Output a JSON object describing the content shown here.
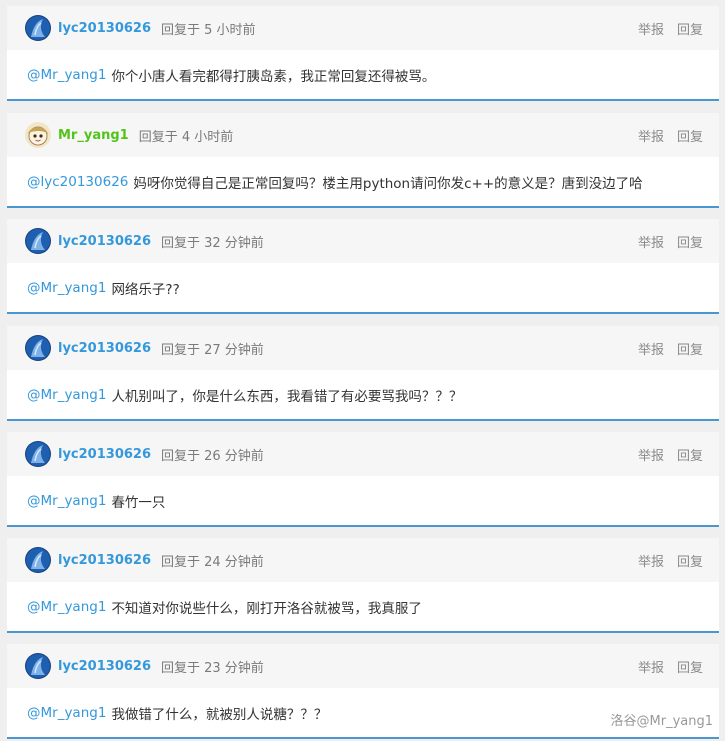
{
  "replies": [
    {
      "username": "lyc20130626",
      "user_color": "#3498db",
      "avatar": "blue-avatar",
      "meta": "回复于 5 小时前",
      "mention": "@Mr_yang1",
      "content": "你个小唐人看完都得打胰岛素，我正常回复还得被骂。",
      "report_label": "举报",
      "reply_label": "回复"
    },
    {
      "username": "Mr_yang1",
      "user_color": "#52c41a",
      "avatar": "anime-avatar",
      "meta": "回复于 4 小时前",
      "mention": "@lyc20130626",
      "content": "妈呀你觉得自己是正常回复吗？楼主用python请问你发c++的意义是？唐到没边了哈",
      "report_label": "举报",
      "reply_label": "回复"
    },
    {
      "username": "lyc20130626",
      "user_color": "#3498db",
      "avatar": "blue-avatar",
      "meta": "回复于 32 分钟前",
      "mention": "@Mr_yang1",
      "content": "网络乐子??",
      "report_label": "举报",
      "reply_label": "回复"
    },
    {
      "username": "lyc20130626",
      "user_color": "#3498db",
      "avatar": "blue-avatar",
      "meta": "回复于 27 分钟前",
      "mention": "@Mr_yang1",
      "content": "人机别叫了，你是什么东西，我看错了有必要骂我吗？？？",
      "report_label": "举报",
      "reply_label": "回复"
    },
    {
      "username": "lyc20130626",
      "user_color": "#3498db",
      "avatar": "blue-avatar",
      "meta": "回复于 26 分钟前",
      "mention": "@Mr_yang1",
      "content": "春竹一只",
      "report_label": "举报",
      "reply_label": "回复"
    },
    {
      "username": "lyc20130626",
      "user_color": "#3498db",
      "avatar": "blue-avatar",
      "meta": "回复于 24 分钟前",
      "mention": "@Mr_yang1",
      "content": "不知道对你说些什么，刚打开洛谷就被骂，我真服了",
      "report_label": "举报",
      "reply_label": "回复"
    },
    {
      "username": "lyc20130626",
      "user_color": "#3498db",
      "avatar": "blue-avatar",
      "meta": "回复于 23 分钟前",
      "mention": "@Mr_yang1",
      "content": "我做错了什么，就被别人说糖？？？",
      "report_label": "举报",
      "reply_label": "回复"
    }
  ],
  "watermark": "洛谷@Mr_yang1"
}
